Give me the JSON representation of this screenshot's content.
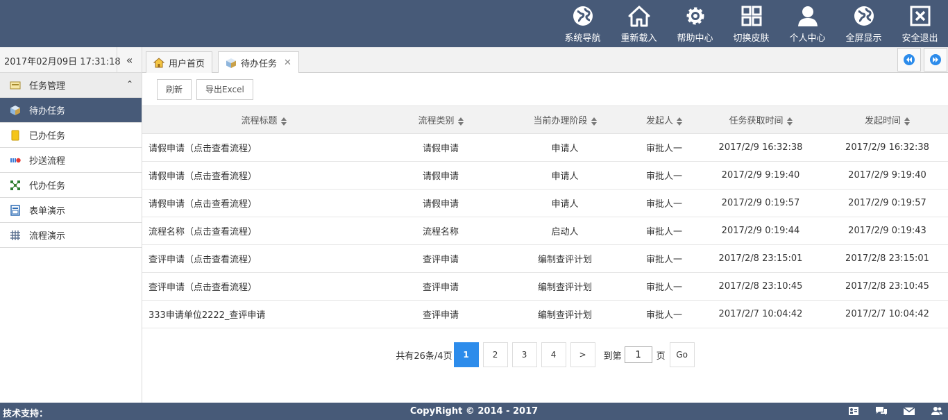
{
  "header": {
    "nav": [
      {
        "label": "系统导航",
        "icon": "globe-icon"
      },
      {
        "label": "重新载入",
        "icon": "home-icon"
      },
      {
        "label": "帮助中心",
        "icon": "gear-icon"
      },
      {
        "label": "切换皮肤",
        "icon": "grid-icon"
      },
      {
        "label": "个人中心",
        "icon": "user-icon"
      },
      {
        "label": "全屏显示",
        "icon": "globe-icon"
      },
      {
        "label": "安全退出",
        "icon": "close-box-icon"
      }
    ]
  },
  "datebar": {
    "datetime": "2017年02月09日 17:31:18",
    "collapse": "«"
  },
  "sidebar": {
    "group": "任务管理",
    "items": [
      {
        "label": "待办任务",
        "icon": "cube-icon",
        "active": true
      },
      {
        "label": "已办任务",
        "icon": "note-icon"
      },
      {
        "label": "抄送流程",
        "icon": "traffic-icon"
      },
      {
        "label": "代办任务",
        "icon": "network-icon"
      },
      {
        "label": "表单演示",
        "icon": "form-icon"
      },
      {
        "label": "流程演示",
        "icon": "flow-icon"
      }
    ]
  },
  "tabs": [
    {
      "label": "用户首页",
      "icon": "home-icon"
    },
    {
      "label": "待办任务",
      "icon": "cube-icon",
      "close": "✕"
    }
  ],
  "toolbar": {
    "refresh": "刷新",
    "export": "导出Excel"
  },
  "table": {
    "columns": [
      "流程标题",
      "流程类别",
      "当前办理阶段",
      "发起人",
      "任务获取时间",
      "发起时间"
    ],
    "rows": [
      [
        "请假申请（点击查看流程）",
        "请假申请",
        "申请人",
        "审批人一",
        "2017/2/9 16:32:38",
        "2017/2/9 16:32:38"
      ],
      [
        "请假申请（点击查看流程）",
        "请假申请",
        "申请人",
        "审批人一",
        "2017/2/9 9:19:40",
        "2017/2/9 9:19:40"
      ],
      [
        "请假申请（点击查看流程）",
        "请假申请",
        "申请人",
        "审批人一",
        "2017/2/9 0:19:57",
        "2017/2/9 0:19:57"
      ],
      [
        "流程名称（点击查看流程）",
        "流程名称",
        "启动人",
        "审批人一",
        "2017/2/9 0:19:44",
        "2017/2/9 0:19:43"
      ],
      [
        "查评申请（点击查看流程）",
        "查评申请",
        "编制查评计划",
        "审批人一",
        "2017/2/8 23:15:01",
        "2017/2/8 23:15:01"
      ],
      [
        "查评申请（点击查看流程）",
        "查评申请",
        "编制查评计划",
        "审批人一",
        "2017/2/8 23:10:45",
        "2017/2/8 23:10:45"
      ],
      [
        "333申请单位2222_查评申请",
        "查评申请",
        "编制查评计划",
        "审批人一",
        "2017/2/7 10:04:42",
        "2017/2/7 10:04:42"
      ]
    ]
  },
  "pager": {
    "total": "共有26条/4页",
    "pages": [
      "1",
      "2",
      "3",
      "4",
      ">"
    ],
    "current": "1",
    "goto_prefix": "到第",
    "goto_value": "1",
    "goto_suffix": "页",
    "go": "Go"
  },
  "footer": {
    "support": "技术支持：",
    "copyright": "CopyRight © 2014 - 2017",
    "icons": [
      "contact-card-icon",
      "chat-icon",
      "mail-icon",
      "users-icon"
    ]
  },
  "colors": {
    "header": "#475a78",
    "active": "#475a78",
    "page_current": "#2d8ceb"
  }
}
